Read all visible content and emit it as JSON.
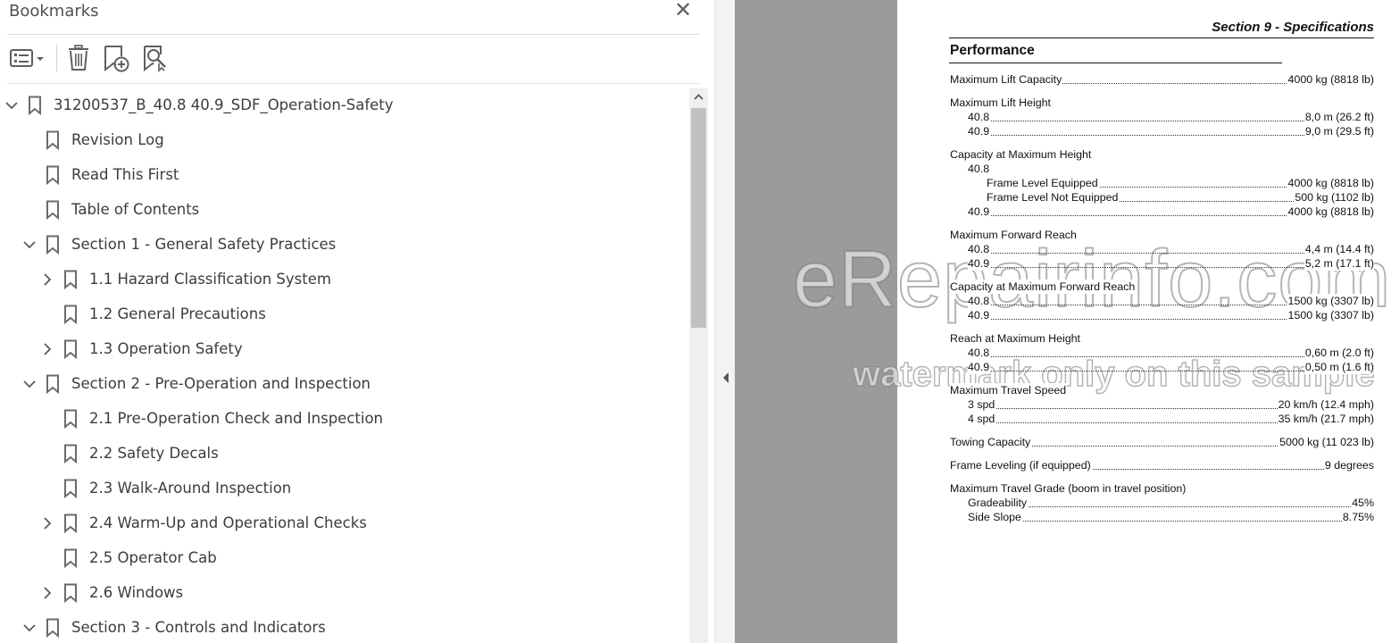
{
  "panel": {
    "title": "Bookmarks",
    "close_symbol": "✕"
  },
  "toolbar": {
    "options_icon": "bookmark-options-icon",
    "delete_icon": "delete-trash-icon",
    "new_bookmark_icon": "new-bookmark-icon",
    "find_bookmark_icon": "find-current-bookmark-icon"
  },
  "tree": [
    {
      "label": "31200537_B_40.8 40.9_SDF_Operation-Safety",
      "level": 0,
      "chevron": "down"
    },
    {
      "label": "Revision Log",
      "level": 1,
      "chevron": "none"
    },
    {
      "label": "Read This First",
      "level": 1,
      "chevron": "none"
    },
    {
      "label": "Table of Contents",
      "level": 1,
      "chevron": "none"
    },
    {
      "label": "Section 1 - General Safety Practices",
      "level": 1,
      "chevron": "down"
    },
    {
      "label": "1.1 Hazard Classification System",
      "level": 2,
      "chevron": "right"
    },
    {
      "label": "1.2 General Precautions",
      "level": 2,
      "chevron": "none"
    },
    {
      "label": "1.3 Operation Safety",
      "level": 2,
      "chevron": "right"
    },
    {
      "label": "Section 2 - Pre-Operation and Inspection",
      "level": 1,
      "chevron": "down"
    },
    {
      "label": "2.1 Pre-Operation Check and Inspection",
      "level": 2,
      "chevron": "none"
    },
    {
      "label": "2.2 Safety Decals",
      "level": 2,
      "chevron": "none"
    },
    {
      "label": "2.3 Walk-Around Inspection",
      "level": 2,
      "chevron": "none"
    },
    {
      "label": "2.4 Warm-Up and Operational Checks",
      "level": 2,
      "chevron": "right"
    },
    {
      "label": "2.5 Operator Cab",
      "level": 2,
      "chevron": "none"
    },
    {
      "label": "2.6 Windows",
      "level": 2,
      "chevron": "right"
    },
    {
      "label": "Section 3 - Controls and Indicators",
      "level": 1,
      "chevron": "down"
    }
  ],
  "colors": {
    "panel_text": "#3c3c3c",
    "icon_grey": "#6b6b6b",
    "grey_page": "#9b9b9b"
  },
  "document": {
    "header": "Section 9 - Specifications",
    "section_title": "Performance",
    "specs": [
      {
        "label": "Maximum Lift Capacity",
        "value": "4000 kg (8818 lb)",
        "indent": 0,
        "dots": true,
        "gap": 0
      },
      {
        "label": "Maximum Lift Height",
        "value": "",
        "indent": 0,
        "dots": false,
        "gap": 1
      },
      {
        "label": "40.8",
        "value": "8,0 m (26.2 ft)",
        "indent": 1,
        "dots": true,
        "gap": 0
      },
      {
        "label": "40.9",
        "value": "9,0 m (29.5 ft)",
        "indent": 1,
        "dots": true,
        "gap": 0
      },
      {
        "label": "Capacity at Maximum Height",
        "value": "",
        "indent": 0,
        "dots": false,
        "gap": 1
      },
      {
        "label": "40.8",
        "value": "",
        "indent": 1,
        "dots": false,
        "gap": 0
      },
      {
        "label": "Frame Level Equipped",
        "value": "4000 kg (8818 lb)",
        "indent": 2,
        "dots": true,
        "gap": 0
      },
      {
        "label": "Frame Level Not Equipped",
        "value": "500 kg (1102 lb)",
        "indent": 2,
        "dots": true,
        "gap": 0
      },
      {
        "label": "40.9",
        "value": "4000 kg (8818 lb)",
        "indent": 1,
        "dots": true,
        "gap": 0
      },
      {
        "label": "Maximum Forward Reach",
        "value": "",
        "indent": 0,
        "dots": false,
        "gap": 1
      },
      {
        "label": "40.8",
        "value": "4,4 m (14.4 ft)",
        "indent": 1,
        "dots": true,
        "gap": 0
      },
      {
        "label": "40.9",
        "value": "5,2 m (17.1 ft)",
        "indent": 1,
        "dots": true,
        "gap": 0
      },
      {
        "label": "Capacity at Maximum Forward Reach",
        "value": "",
        "indent": 0,
        "dots": false,
        "gap": 1
      },
      {
        "label": "40.8",
        "value": "1500 kg (3307 lb)",
        "indent": 1,
        "dots": true,
        "gap": 0
      },
      {
        "label": "40.9",
        "value": "1500 kg (3307 lb)",
        "indent": 1,
        "dots": true,
        "gap": 0
      },
      {
        "label": "Reach at Maximum Height",
        "value": "",
        "indent": 0,
        "dots": false,
        "gap": 1
      },
      {
        "label": "40.8",
        "value": "0,60 m (2.0 ft)",
        "indent": 1,
        "dots": true,
        "gap": 0
      },
      {
        "label": "40.9",
        "value": "0,50 m (1.6 ft)",
        "indent": 1,
        "dots": true,
        "gap": 0
      },
      {
        "label": "Maximum Travel Speed",
        "value": "",
        "indent": 0,
        "dots": false,
        "gap": 1
      },
      {
        "label": "3 spd",
        "value": "20 km/h (12.4 mph)",
        "indent": 1,
        "dots": true,
        "gap": 0
      },
      {
        "label": "4 spd",
        "value": "35 km/h (21.7 mph)",
        "indent": 1,
        "dots": true,
        "gap": 0
      },
      {
        "label": "Towing Capacity",
        "value": "5000 kg (11 023 lb)",
        "indent": 0,
        "dots": true,
        "gap": 1
      },
      {
        "label": "Frame Leveling (if equipped)",
        "value": "9 degrees",
        "indent": 0,
        "dots": true,
        "gap": 1
      },
      {
        "label": "Maximum Travel Grade (boom in travel position)",
        "value": "",
        "indent": 0,
        "dots": false,
        "gap": 1
      },
      {
        "label": "Gradeability",
        "value": "45%",
        "indent": 1,
        "dots": true,
        "gap": 0
      },
      {
        "label": "Side Slope",
        "value": "8.75%",
        "indent": 1,
        "dots": true,
        "gap": 0
      }
    ]
  },
  "watermark": {
    "line1": "eRepairinfo.com",
    "line2": "watermark only on this sample"
  }
}
